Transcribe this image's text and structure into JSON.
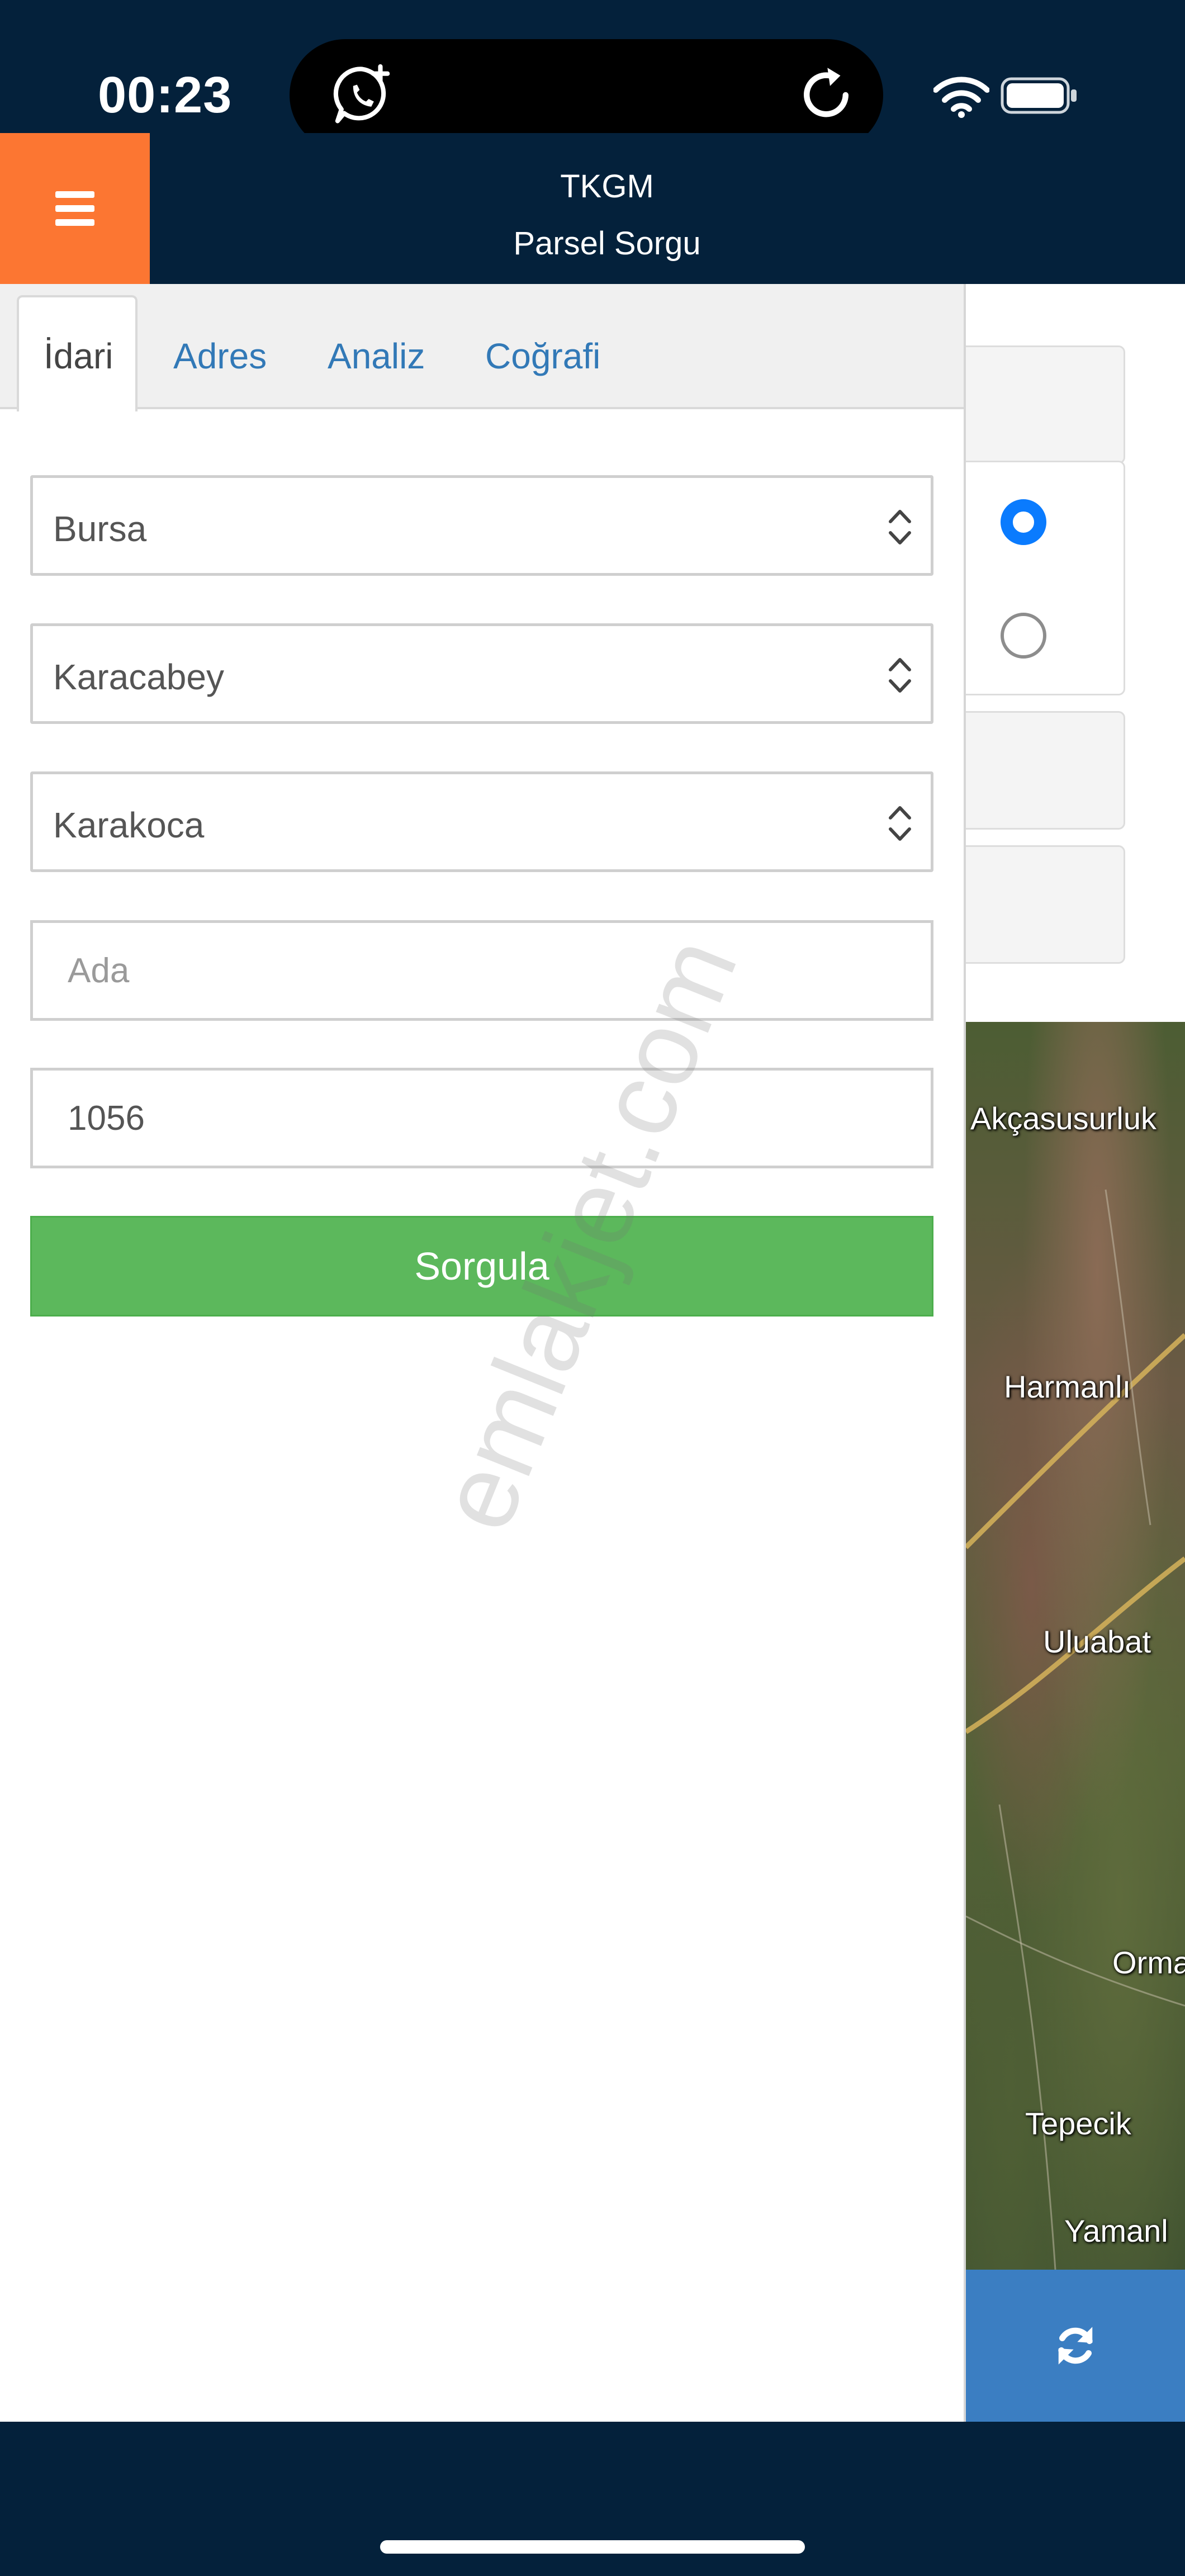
{
  "status_bar": {
    "time": "00:23"
  },
  "header": {
    "title": "TKGM",
    "subtitle": "Parsel Sorgu"
  },
  "tabs": [
    {
      "label": "İdari",
      "active": true
    },
    {
      "label": "Adres"
    },
    {
      "label": "Analiz"
    },
    {
      "label": "Coğrafi"
    }
  ],
  "form": {
    "il": "Bursa",
    "ilce": "Karacabey",
    "mahalle": "Karakoca",
    "ada_placeholder": "Ada",
    "ada_value": "",
    "parsel_value": "1056",
    "query_label": "Sorgula"
  },
  "map": {
    "labels": [
      "Akçasusurluk",
      "Harmanlı",
      "Uluabat",
      "Orma",
      "Tepecik",
      "Yamanl"
    ]
  },
  "watermark": "emlakjet.com",
  "colors": {
    "header_bg": "#04213b",
    "menu_accent": "#fc7632",
    "tab_link": "#3279b7",
    "query_button": "#5cb85c",
    "map_refresh_button": "#3b7ec2",
    "radio_selected": "#0a7bfe"
  }
}
